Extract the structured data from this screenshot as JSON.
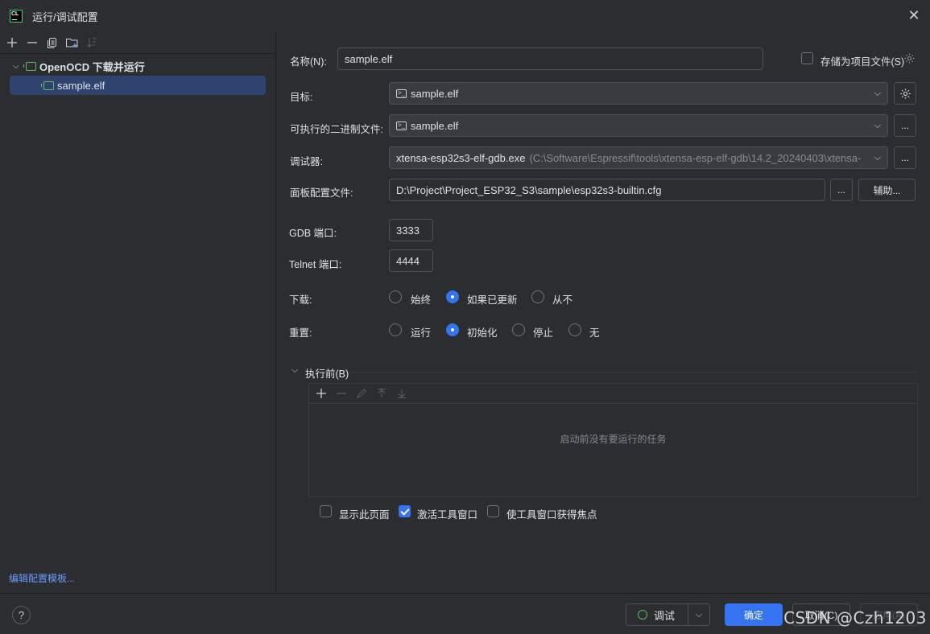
{
  "window": {
    "title": "运行/调试配置",
    "app_icon": "CL"
  },
  "left": {
    "toolbar": [
      "add-icon",
      "remove-icon",
      "copy-icon",
      "folder-icon",
      "sort-icon"
    ],
    "tree": {
      "group_label": "OpenOCD 下载并运行",
      "item_label": "sample.elf"
    },
    "edit_templates": "编辑配置模板..."
  },
  "form": {
    "name_label": "名称(N):",
    "name_value": "sample.elf",
    "store_label": "存储为项目文件(S)",
    "target_label": "目标:",
    "target_value": "sample.elf",
    "exec_label": "可执行的二进制文件:",
    "exec_value": "sample.elf",
    "debugger_label": "调试器:",
    "debugger_value": "xtensa-esp32s3-elf-gdb.exe",
    "debugger_path": "(C:\\Software\\Espressif\\tools\\xtensa-esp-elf-gdb\\14.2_20240403\\xtensa-",
    "board_label": "面板配置文件:",
    "board_value": "D:\\Project\\Project_ESP32_S3\\sample\\esp32s3-builtin.cfg",
    "browse": "...",
    "assist": "辅助...",
    "gdb_port_label": "GDB 端口:",
    "gdb_port_value": "3333",
    "telnet_port_label": "Telnet 端口:",
    "telnet_port_value": "4444",
    "download_label": "下载:",
    "download_options": [
      "始终",
      "如果已更新",
      "从不"
    ],
    "download_selected": "如果已更新",
    "reset_label": "重置:",
    "reset_options": [
      "运行",
      "初始化",
      "停止",
      "无"
    ],
    "reset_selected": "初始化",
    "before_launch_label": "执行前(B)",
    "tasks_empty": "启动前没有要运行的任务",
    "show_page": "显示此页面",
    "activate_tool": "激活工具窗口",
    "focus_tool": "使工具窗口获得焦点"
  },
  "bottom": {
    "help": "?",
    "debug": "调试",
    "ok": "确定",
    "cancel": "取消(C)",
    "apply": "应用(A)",
    "watermark": "CSDN @Czh1203"
  }
}
